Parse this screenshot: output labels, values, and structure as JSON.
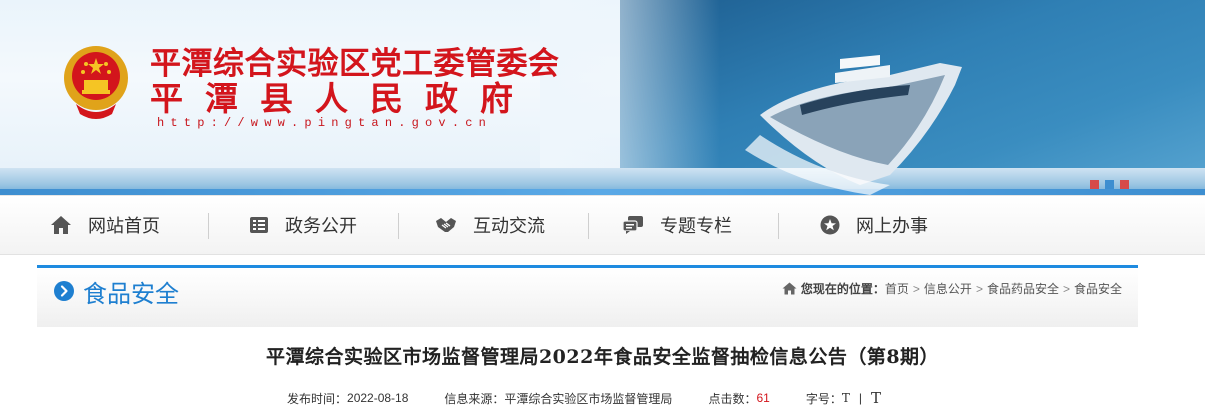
{
  "header": {
    "org_line1": "平潭综合实验区党工委管委会",
    "org_line2": "平潭县人民政府",
    "url": "http://www.pingtan.gov.cn",
    "emblem_icon": "national-emblem-icon",
    "colors": {
      "brand_red": "#d3151c",
      "sea_blue": "#2f7fb4"
    },
    "slide_dots": [
      "#d64a4a",
      "#3d8ed0",
      "#d64a4a"
    ]
  },
  "nav": {
    "items": [
      {
        "label": "网站首页",
        "icon": "home-icon"
      },
      {
        "label": "政务公开",
        "icon": "document-list-icon"
      },
      {
        "label": "互动交流",
        "icon": "handshake-icon"
      },
      {
        "label": "专题专栏",
        "icon": "chat-bubbles-icon"
      },
      {
        "label": "网上办事",
        "icon": "star-circle-icon"
      }
    ]
  },
  "column": {
    "title": "食品安全",
    "icon": "chevron-right-circle-icon",
    "accent": "#1e8be0"
  },
  "breadcrumb": {
    "prefix": "您现在的位置：",
    "items": [
      "首页",
      "信息公开",
      "食品药品安全",
      "食品安全"
    ],
    "separator": ">"
  },
  "article": {
    "title": "平潭综合实验区市场监督管理局2022年食品安全监督抽检信息公告（第8期）",
    "publish_label": "发布时间：",
    "publish_date": "2022-08-18",
    "source_label": "信息来源：",
    "source": "平潭综合实验区市场监督管理局",
    "hits_label": "点击数：",
    "hits": "61",
    "fontsize_label": "字号：",
    "font_small": "T",
    "font_large": "T",
    "font_sep": "|"
  }
}
